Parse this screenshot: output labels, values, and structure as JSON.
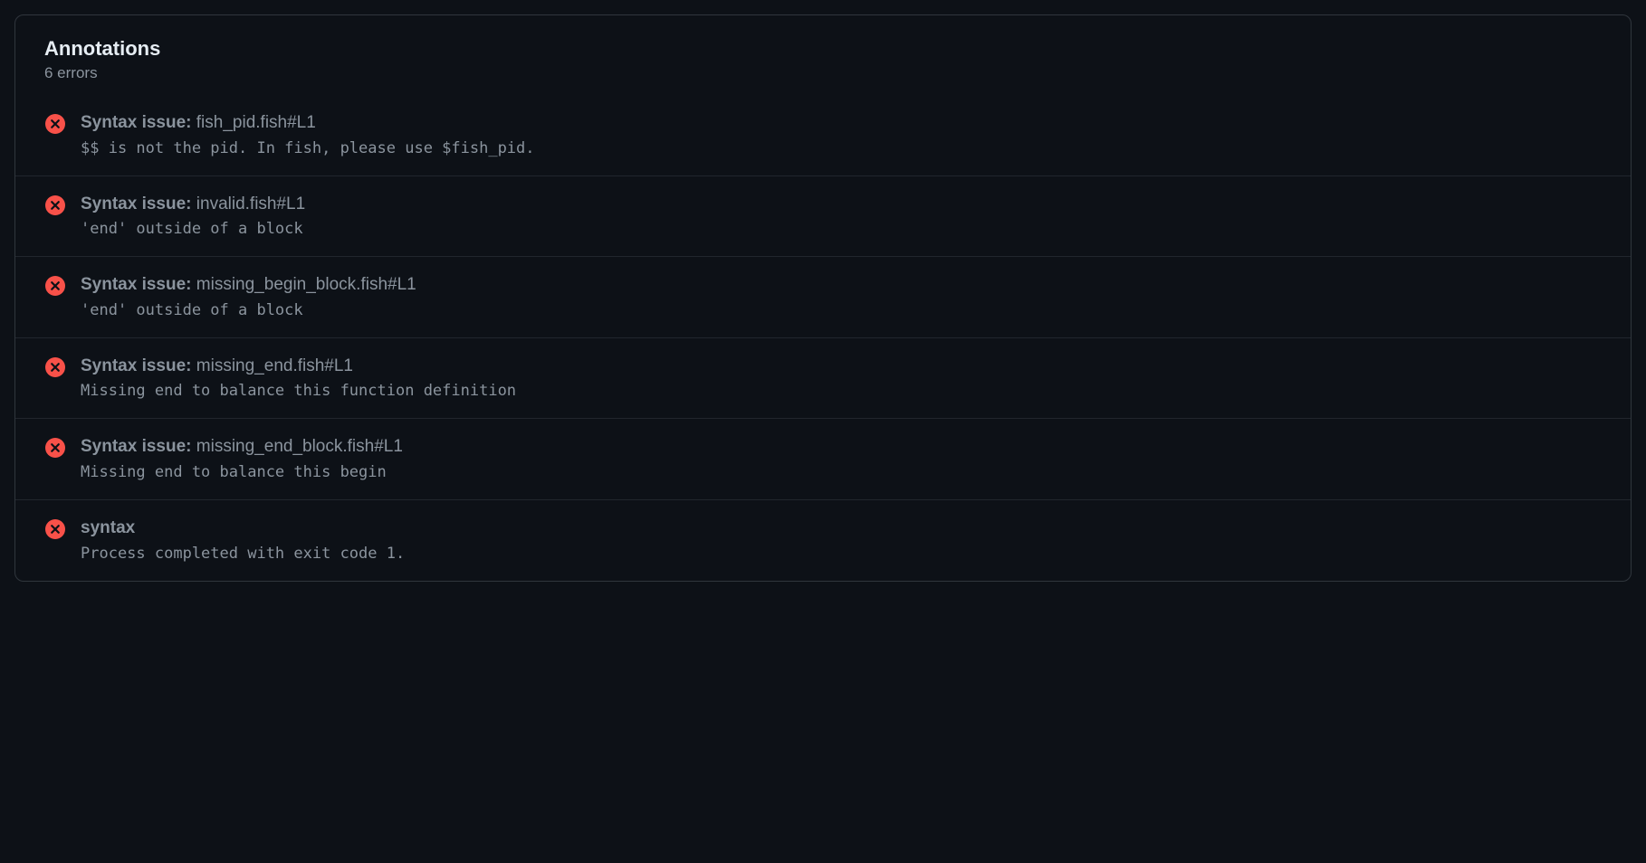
{
  "panel": {
    "title": "Annotations",
    "subtitle": "6 errors"
  },
  "items": [
    {
      "title_prefix": "Syntax issue: ",
      "location": "fish_pid.fish#L1",
      "message": "$$ is not the pid. In fish, please use $fish_pid."
    },
    {
      "title_prefix": "Syntax issue: ",
      "location": "invalid.fish#L1",
      "message": "'end' outside of a block"
    },
    {
      "title_prefix": "Syntax issue: ",
      "location": "missing_begin_block.fish#L1",
      "message": "'end' outside of a block"
    },
    {
      "title_prefix": "Syntax issue: ",
      "location": "missing_end.fish#L1",
      "message": "Missing end to balance this function definition"
    },
    {
      "title_prefix": "Syntax issue: ",
      "location": "missing_end_block.fish#L1",
      "message": "Missing end to balance this begin"
    },
    {
      "title_prefix": "syntax",
      "location": "",
      "message": "Process completed with exit code 1."
    }
  ]
}
